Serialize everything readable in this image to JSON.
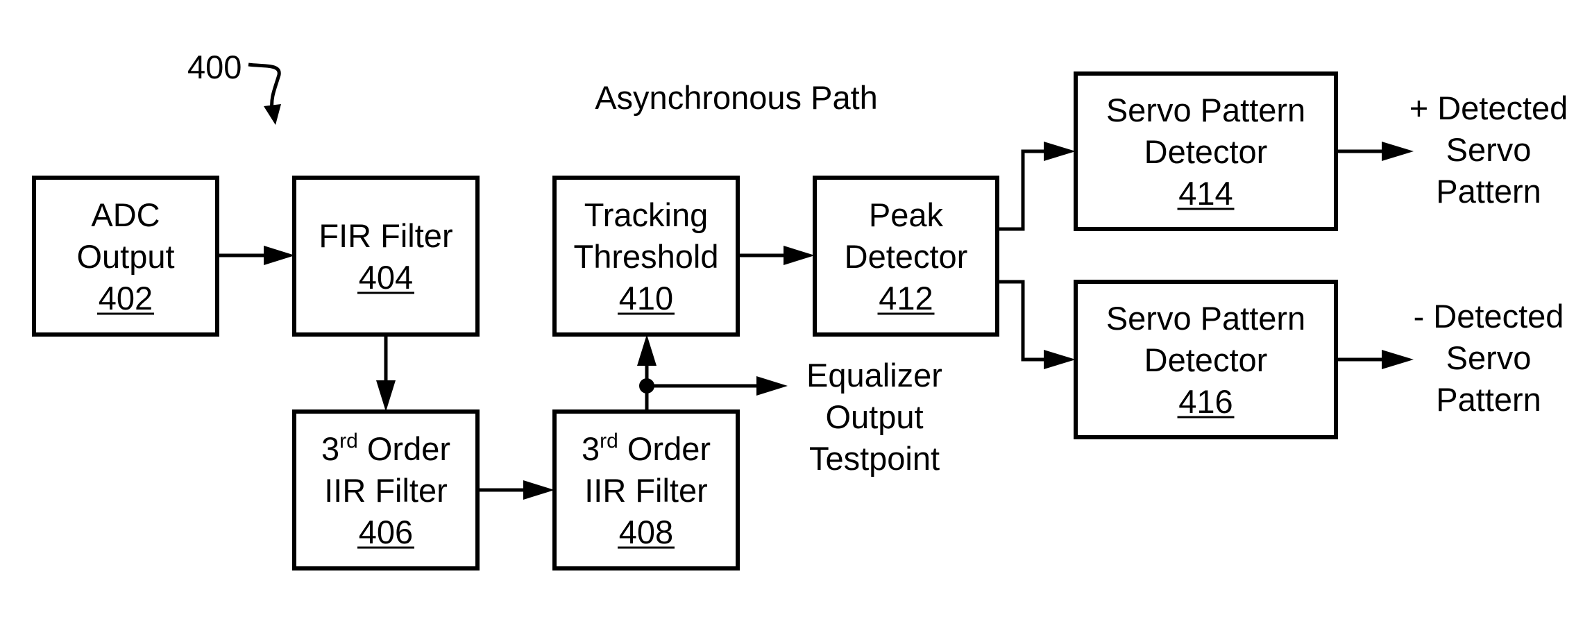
{
  "figure": {
    "ref_label": "400",
    "path_label": "Asynchronous Path"
  },
  "blocks": [
    {
      "id": "adc",
      "lines": [
        "ADC",
        "Output"
      ],
      "ref": "402"
    },
    {
      "id": "fir",
      "lines": [
        "FIR Filter"
      ],
      "ref": "404"
    },
    {
      "id": "iir1",
      "lines": [
        "3|rd| Order",
        "IIR Filter"
      ],
      "ref": "406"
    },
    {
      "id": "iir2",
      "lines": [
        "3|rd| Order",
        "IIR Filter"
      ],
      "ref": "408"
    },
    {
      "id": "track",
      "lines": [
        "Tracking",
        "Threshold"
      ],
      "ref": "410"
    },
    {
      "id": "peak",
      "lines": [
        "Peak",
        "Detector"
      ],
      "ref": "412"
    },
    {
      "id": "servo_pos",
      "lines": [
        "Servo Pattern",
        "Detector"
      ],
      "ref": "414"
    },
    {
      "id": "servo_neg",
      "lines": [
        "Servo Pattern",
        "Detector"
      ],
      "ref": "416"
    }
  ],
  "outputs": {
    "testpoint": [
      "Equalizer",
      "Output",
      "Testpoint"
    ],
    "positive": [
      "+ Detected",
      "Servo",
      "Pattern"
    ],
    "negative": [
      "- Detected",
      "Servo",
      "Pattern"
    ]
  },
  "connections": [
    {
      "from": "adc",
      "to": "fir"
    },
    {
      "from": "fir",
      "to": "iir1"
    },
    {
      "from": "iir1",
      "to": "iir2"
    },
    {
      "from": "iir2",
      "to": "track"
    },
    {
      "from": "iir2",
      "to": "testpoint"
    },
    {
      "from": "track",
      "to": "peak"
    },
    {
      "from": "peak",
      "to": "servo_pos"
    },
    {
      "from": "peak",
      "to": "servo_neg"
    },
    {
      "from": "servo_pos",
      "to": "positive"
    },
    {
      "from": "servo_neg",
      "to": "negative"
    }
  ]
}
